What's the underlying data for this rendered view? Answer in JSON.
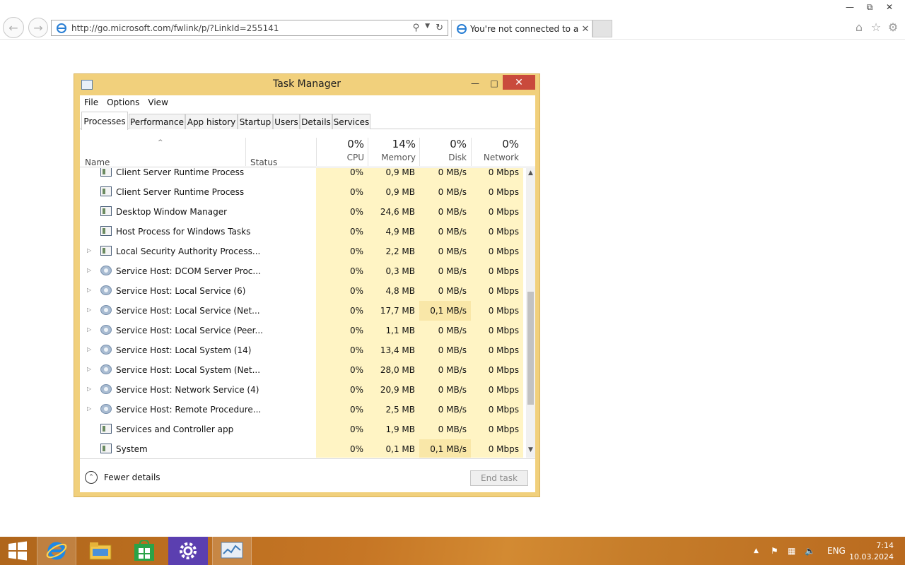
{
  "browser": {
    "url": "http://go.microsoft.com/fwlink/p/?LinkId=255141",
    "tab_title": "You're not connected to a ...",
    "window_controls": [
      "minimize",
      "restore",
      "close"
    ]
  },
  "task_manager": {
    "title": "Task Manager",
    "menu": [
      "File",
      "Options",
      "View"
    ],
    "tabs": [
      "Processes",
      "Performance",
      "App history",
      "Startup",
      "Users",
      "Details",
      "Services"
    ],
    "active_tab": "Processes",
    "columns": {
      "name": "Name",
      "status": "Status",
      "cpu": {
        "percent": "0%",
        "label": "CPU"
      },
      "memory": {
        "percent": "14%",
        "label": "Memory"
      },
      "disk": {
        "percent": "0%",
        "label": "Disk"
      },
      "network": {
        "percent": "0%",
        "label": "Network"
      }
    },
    "rows": [
      {
        "name": "Client Server Runtime Process",
        "icon": "app-icon",
        "expandable": false,
        "cpu": "0%",
        "memory": "0,9 MB",
        "disk": "0 MB/s",
        "network": "0 Mbps"
      },
      {
        "name": "Client Server Runtime Process",
        "icon": "app-icon",
        "expandable": false,
        "cpu": "0%",
        "memory": "0,9 MB",
        "disk": "0 MB/s",
        "network": "0 Mbps"
      },
      {
        "name": "Desktop Window Manager",
        "icon": "app-icon",
        "expandable": false,
        "cpu": "0%",
        "memory": "24,6 MB",
        "disk": "0 MB/s",
        "network": "0 Mbps"
      },
      {
        "name": "Host Process for Windows Tasks",
        "icon": "app-icon",
        "expandable": false,
        "cpu": "0%",
        "memory": "4,9 MB",
        "disk": "0 MB/s",
        "network": "0 Mbps"
      },
      {
        "name": "Local Security Authority Process...",
        "icon": "app-icon",
        "expandable": true,
        "cpu": "0%",
        "memory": "2,2 MB",
        "disk": "0 MB/s",
        "network": "0 Mbps"
      },
      {
        "name": "Service Host: DCOM Server Proc...",
        "icon": "gear-icon",
        "expandable": true,
        "cpu": "0%",
        "memory": "0,3 MB",
        "disk": "0 MB/s",
        "network": "0 Mbps"
      },
      {
        "name": "Service Host: Local Service (6)",
        "icon": "gear-icon",
        "expandable": true,
        "cpu": "0%",
        "memory": "4,8 MB",
        "disk": "0 MB/s",
        "network": "0 Mbps"
      },
      {
        "name": "Service Host: Local Service (Net...",
        "icon": "gear-icon",
        "expandable": true,
        "cpu": "0%",
        "memory": "17,7 MB",
        "disk": "0,1 MB/s",
        "network": "0 Mbps"
      },
      {
        "name": "Service Host: Local Service (Peer...",
        "icon": "gear-icon",
        "expandable": true,
        "cpu": "0%",
        "memory": "1,1 MB",
        "disk": "0 MB/s",
        "network": "0 Mbps"
      },
      {
        "name": "Service Host: Local System (14)",
        "icon": "gear-icon",
        "expandable": true,
        "cpu": "0%",
        "memory": "13,4 MB",
        "disk": "0 MB/s",
        "network": "0 Mbps"
      },
      {
        "name": "Service Host: Local System (Net...",
        "icon": "gear-icon",
        "expandable": true,
        "cpu": "0%",
        "memory": "28,0 MB",
        "disk": "0 MB/s",
        "network": "0 Mbps"
      },
      {
        "name": "Service Host: Network Service (4)",
        "icon": "gear-icon",
        "expandable": true,
        "cpu": "0%",
        "memory": "20,9 MB",
        "disk": "0 MB/s",
        "network": "0 Mbps"
      },
      {
        "name": "Service Host: Remote Procedure...",
        "icon": "gear-icon",
        "expandable": true,
        "cpu": "0%",
        "memory": "2,5 MB",
        "disk": "0 MB/s",
        "network": "0 Mbps"
      },
      {
        "name": "Services and Controller app",
        "icon": "app-icon",
        "expandable": false,
        "cpu": "0%",
        "memory": "1,9 MB",
        "disk": "0 MB/s",
        "network": "0 Mbps"
      },
      {
        "name": "System",
        "icon": "app-icon",
        "expandable": false,
        "cpu": "0%",
        "memory": "0,1 MB",
        "disk": "0,1 MB/s",
        "network": "0 Mbps"
      }
    ],
    "fewer_details": "Fewer details",
    "end_task": "End task"
  },
  "taskbar": {
    "apps": [
      "start-icon",
      "internet-explorer-icon",
      "file-explorer-icon",
      "store-icon",
      "settings-icon",
      "task-manager-icon"
    ],
    "language": "ENG",
    "time": "7:14",
    "date": "10.03.2024"
  },
  "colors": {
    "window_frame": "#f1d07c",
    "close_button": "#c94a3c",
    "heat_light": "#fff4c4",
    "heat_mid": "#f9e7a8",
    "taskbar": "#c67625"
  }
}
